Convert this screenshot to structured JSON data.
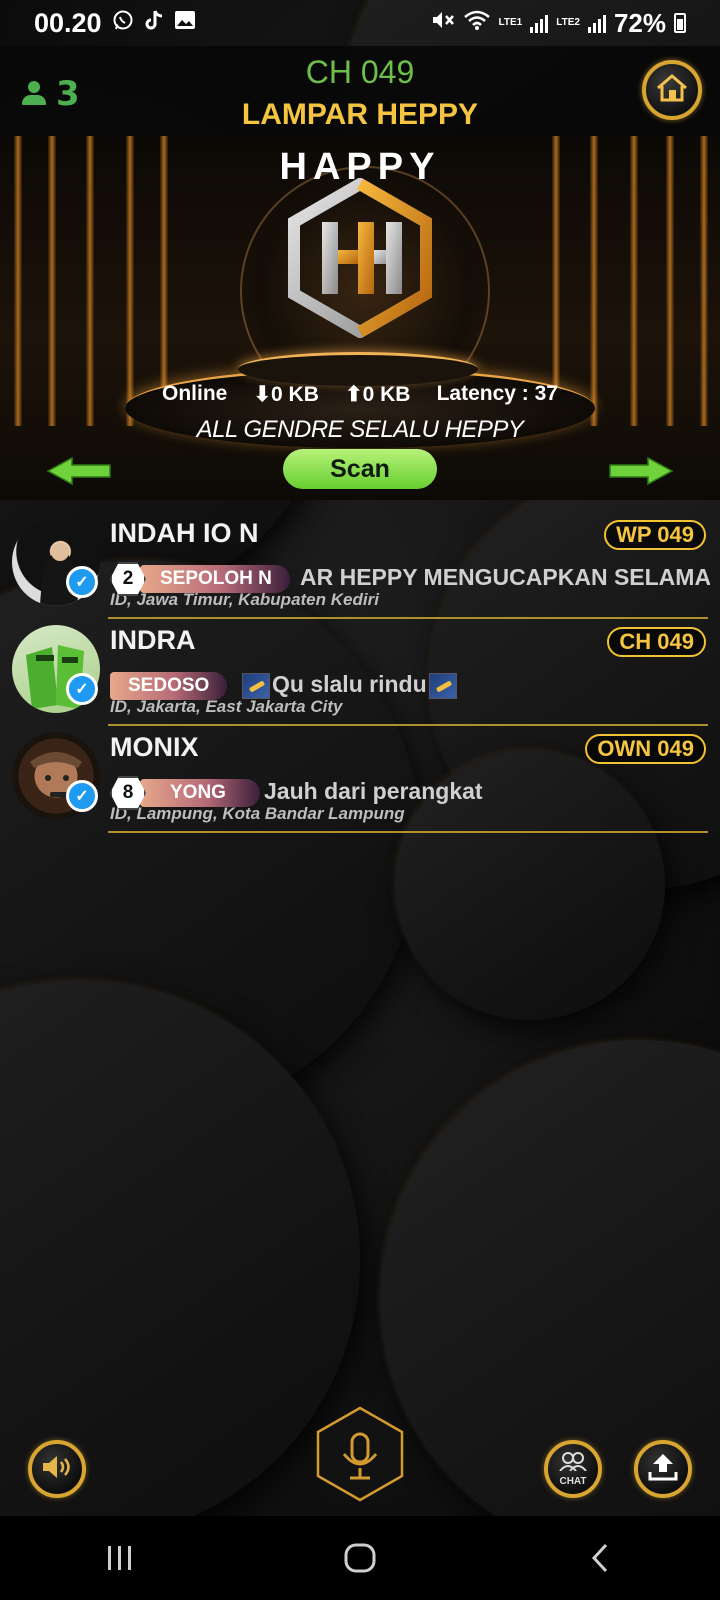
{
  "status_bar": {
    "time": "00.20",
    "battery": "72%",
    "sim1": "LTE1",
    "sim2": "LTE2",
    "icons": [
      "whatsapp-icon",
      "tiktok-icon",
      "gallery-icon",
      "mute-icon",
      "wifi-icon",
      "signal-icon",
      "battery-icon"
    ]
  },
  "header": {
    "user_count": "3",
    "channel": "CH 049",
    "room_name": "LAMPAR HEPPY"
  },
  "banner": {
    "brand": "HAPPY",
    "online_label": "Online",
    "download": "0 KB",
    "upload": "0 KB",
    "latency_label": "Latency :",
    "latency_value": "37",
    "tagline": "ALL GENDRE SELALU HEPPY",
    "scan_label": "Scan"
  },
  "users": [
    {
      "name": "INDAH IO N",
      "badge": "WP 049",
      "level": "2",
      "tag": "SEPOLOH N",
      "status": "AR HEPPY MENGUCAPKAN SELAMA",
      "location": "ID, Jawa Timur, Kabupaten Kediri"
    },
    {
      "name": "INDRA",
      "badge": "CH 049",
      "level": "",
      "tag": "SEDOSO",
      "status": "Qu slalu rindu",
      "location": "ID, Jakarta, East Jakarta City"
    },
    {
      "name": "MONIX",
      "badge": "OWN 049",
      "level": "8",
      "tag": "YONG",
      "status": "Jauh dari perangkat",
      "location": "ID, Lampung, Kota Bandar Lampung"
    }
  ],
  "controls": {
    "chat_label": "CHAT"
  },
  "colors": {
    "accent_gold": "#f5c542",
    "accent_green": "#6cc04a",
    "verified_blue": "#1e9bf0"
  }
}
